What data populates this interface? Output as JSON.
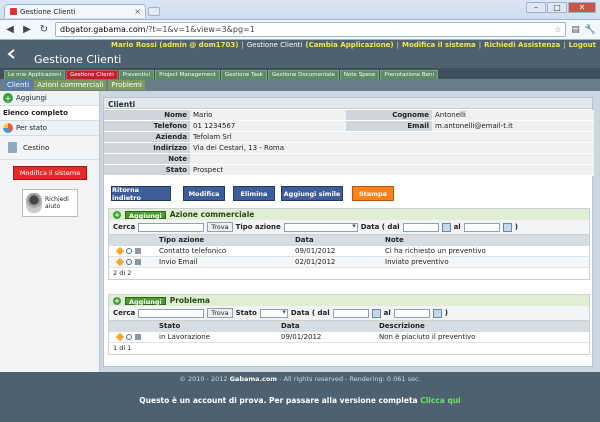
{
  "browser": {
    "tab_title": "Gestione Clienti",
    "tab_close": "×",
    "url_host": "dbgator.gabama.com",
    "url_path": "/?t=1&v=1&view=3&pg=1",
    "back": "◀",
    "forward": "▶",
    "reload": "↻",
    "star": "☆",
    "page_icon": "▤",
    "wrench": "🔧",
    "minimize": "–",
    "maximize": "□",
    "close": "✕"
  },
  "header": {
    "app_title": "Gestione Clienti",
    "user": "Mario Rossi (admin @ dom1703)",
    "sep": "|",
    "app_name": "Gestione Clienti",
    "change_app": "(Cambia Applicazione)",
    "modify_system": "Modifica il sistema",
    "help_request": "Richiedi Assistenza",
    "logout": "Logout"
  },
  "modules": [
    "Le mie Applicazioni",
    "Gestione Clienti",
    "Preventivi",
    "Project Management",
    "Gestione Task",
    "Gestione Documentale",
    "Note Spese",
    "Prenotazione Beni"
  ],
  "subtabs": [
    "Clienti",
    "Azioni commerciali",
    "Problemi"
  ],
  "sidebar": {
    "add": "Aggiungi",
    "plus": "+",
    "list": "Elenco completo",
    "by_state": "Per stato",
    "trash": "Cestino",
    "modify_system": "Modifica il sistema",
    "help_line1": "Richiedi",
    "help_line2": "aiuto"
  },
  "client": {
    "section_title": "Clienti",
    "labels": {
      "nome": "Nome",
      "cognome": "Cognome",
      "telefono": "Telefono",
      "email": "Email",
      "azienda": "Azienda",
      "indirizzo": "Indirizzo",
      "note": "Note",
      "stato": "Stato"
    },
    "values": {
      "nome": "Mario",
      "cognome": "Antonelli",
      "telefono": "01 1234567",
      "email": "m.antonelli@email-t.it",
      "azienda": "Tefolam Srl",
      "indirizzo": "Via dei Cestari, 13 - Roma",
      "note": "",
      "stato": "Prospect"
    }
  },
  "actions": {
    "back": "Ritorna indietro",
    "edit": "Modifica",
    "delete": "Elimina",
    "add_similar": "Aggiungi simile",
    "print": "Stampa"
  },
  "commercial": {
    "add": "Aggiungi",
    "plus": "+",
    "title": "Azione commerciale",
    "search_label": "Cerca",
    "find_btn": "Trova",
    "type_label": "Tipo azione",
    "date_label": "Data ( dal",
    "to_label": "al",
    "close_paren": ")",
    "columns": [
      "Tipo azione",
      "Data",
      "Note"
    ],
    "rows": [
      {
        "tipo": "Contatto telefonico",
        "data": "09/01/2012",
        "note": "Ci ha richiesto un preventivo"
      },
      {
        "tipo": "Invio Email",
        "data": "02/01/2012",
        "note": "Inviato preventivo"
      }
    ],
    "pager": "2 di 2"
  },
  "problem": {
    "add": "Aggiungi",
    "plus": "+",
    "title": "Problema",
    "search_label": "Cerca",
    "find_btn": "Trova",
    "state_label": "Stato",
    "date_label": "Data ( dal",
    "to_label": "al",
    "close_paren": ")",
    "columns": [
      "Stato",
      "Data",
      "Descrizione"
    ],
    "rows": [
      {
        "stato": "in Lavorazione",
        "data": "09/01/2012",
        "descrizione": "Non è piaciuto il preventivo"
      }
    ],
    "pager": "1 di 1"
  },
  "footer": {
    "copyright_pre": "© 2010 - 2012",
    "copyright_brand": "Gabama.com",
    "copyright_post": "- All rights reserved - Rendering: 0.061 sec.",
    "trial_text": "Questo è un account di prova. Per passare alla versione completa",
    "trial_cta": "Clicca qui"
  },
  "colors": {
    "header_bg": "#4e6170",
    "active_module": "#b8242a",
    "module_tab": "#5b8a64",
    "action_button": "#3e5d99",
    "print_button": "#f7821a",
    "danger_button": "#e42a2a",
    "cta": "#6ee35a"
  }
}
